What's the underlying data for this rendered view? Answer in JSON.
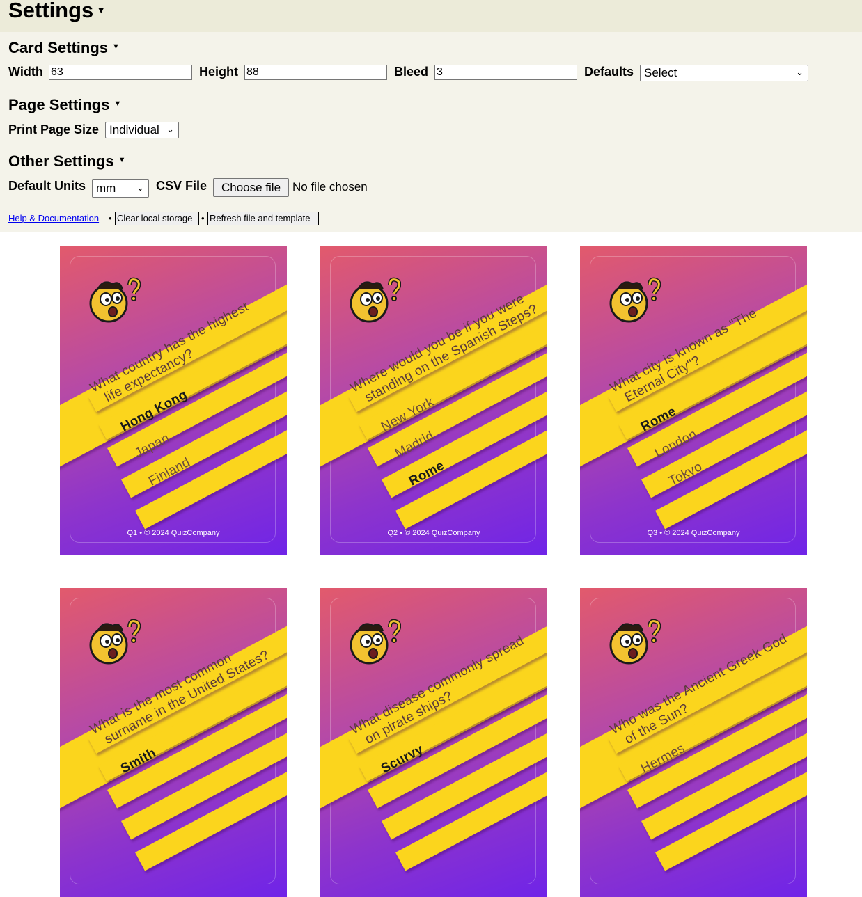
{
  "header": {
    "title": "Settings"
  },
  "card_settings": {
    "title": "Card Settings",
    "width_label": "Width",
    "width_value": "63",
    "height_label": "Height",
    "height_value": "88",
    "bleed_label": "Bleed",
    "bleed_value": "3",
    "defaults_label": "Defaults",
    "defaults_value": "Select"
  },
  "page_settings": {
    "title": "Page Settings",
    "print_size_label": "Print Page Size",
    "print_size_value": "Individual"
  },
  "other_settings": {
    "title": "Other Settings",
    "units_label": "Default Units",
    "units_value": "mm",
    "csv_label": "CSV File",
    "choose_file_label": "Choose file",
    "file_status": "No file chosen"
  },
  "links": {
    "help": "Help & Documentation",
    "separator": "•",
    "clear_storage": "Clear local storage",
    "refresh": "Refresh file and template"
  },
  "colors": {
    "band": "#fbd51d",
    "gradient_top": "#e25a6c",
    "gradient_bottom": "#6f24e8",
    "title_bg": "#ecebd9",
    "panel_bg": "#f4f3ea"
  },
  "cards": [
    {
      "question_line1": "What country has the highest",
      "question_line2": "life expectancy?",
      "answers": [
        "Hong Kong",
        "Japan",
        "Finland"
      ],
      "correct": 0,
      "footer": "Q1 • © 2024 QuizCompany"
    },
    {
      "question_line1": "Where would you be if you were",
      "question_line2": "standing on the Spanish Steps?",
      "answers": [
        "New York",
        "Madrid",
        "Rome"
      ],
      "correct": 2,
      "footer": "Q2 • © 2024 QuizCompany"
    },
    {
      "question_line1": "What city is known as \"The",
      "question_line2": "Eternal City\"?",
      "answers": [
        "Rome",
        "London",
        "Tokyo"
      ],
      "correct": 0,
      "footer": "Q3 • © 2024 QuizCompany"
    },
    {
      "question_line1": "What is the most common",
      "question_line2": "surname in the United States?",
      "answers": [
        "Smith",
        "",
        ""
      ],
      "correct": 0,
      "footer": ""
    },
    {
      "question_line1": "What disease commonly spread",
      "question_line2": "on pirate ships?",
      "answers": [
        "Scurvy",
        "",
        ""
      ],
      "correct": 0,
      "footer": ""
    },
    {
      "question_line1": "Who was the Ancient Greek God",
      "question_line2": "of the Sun?",
      "answers": [
        "Hermes",
        "",
        ""
      ],
      "correct": -1,
      "footer": ""
    }
  ]
}
